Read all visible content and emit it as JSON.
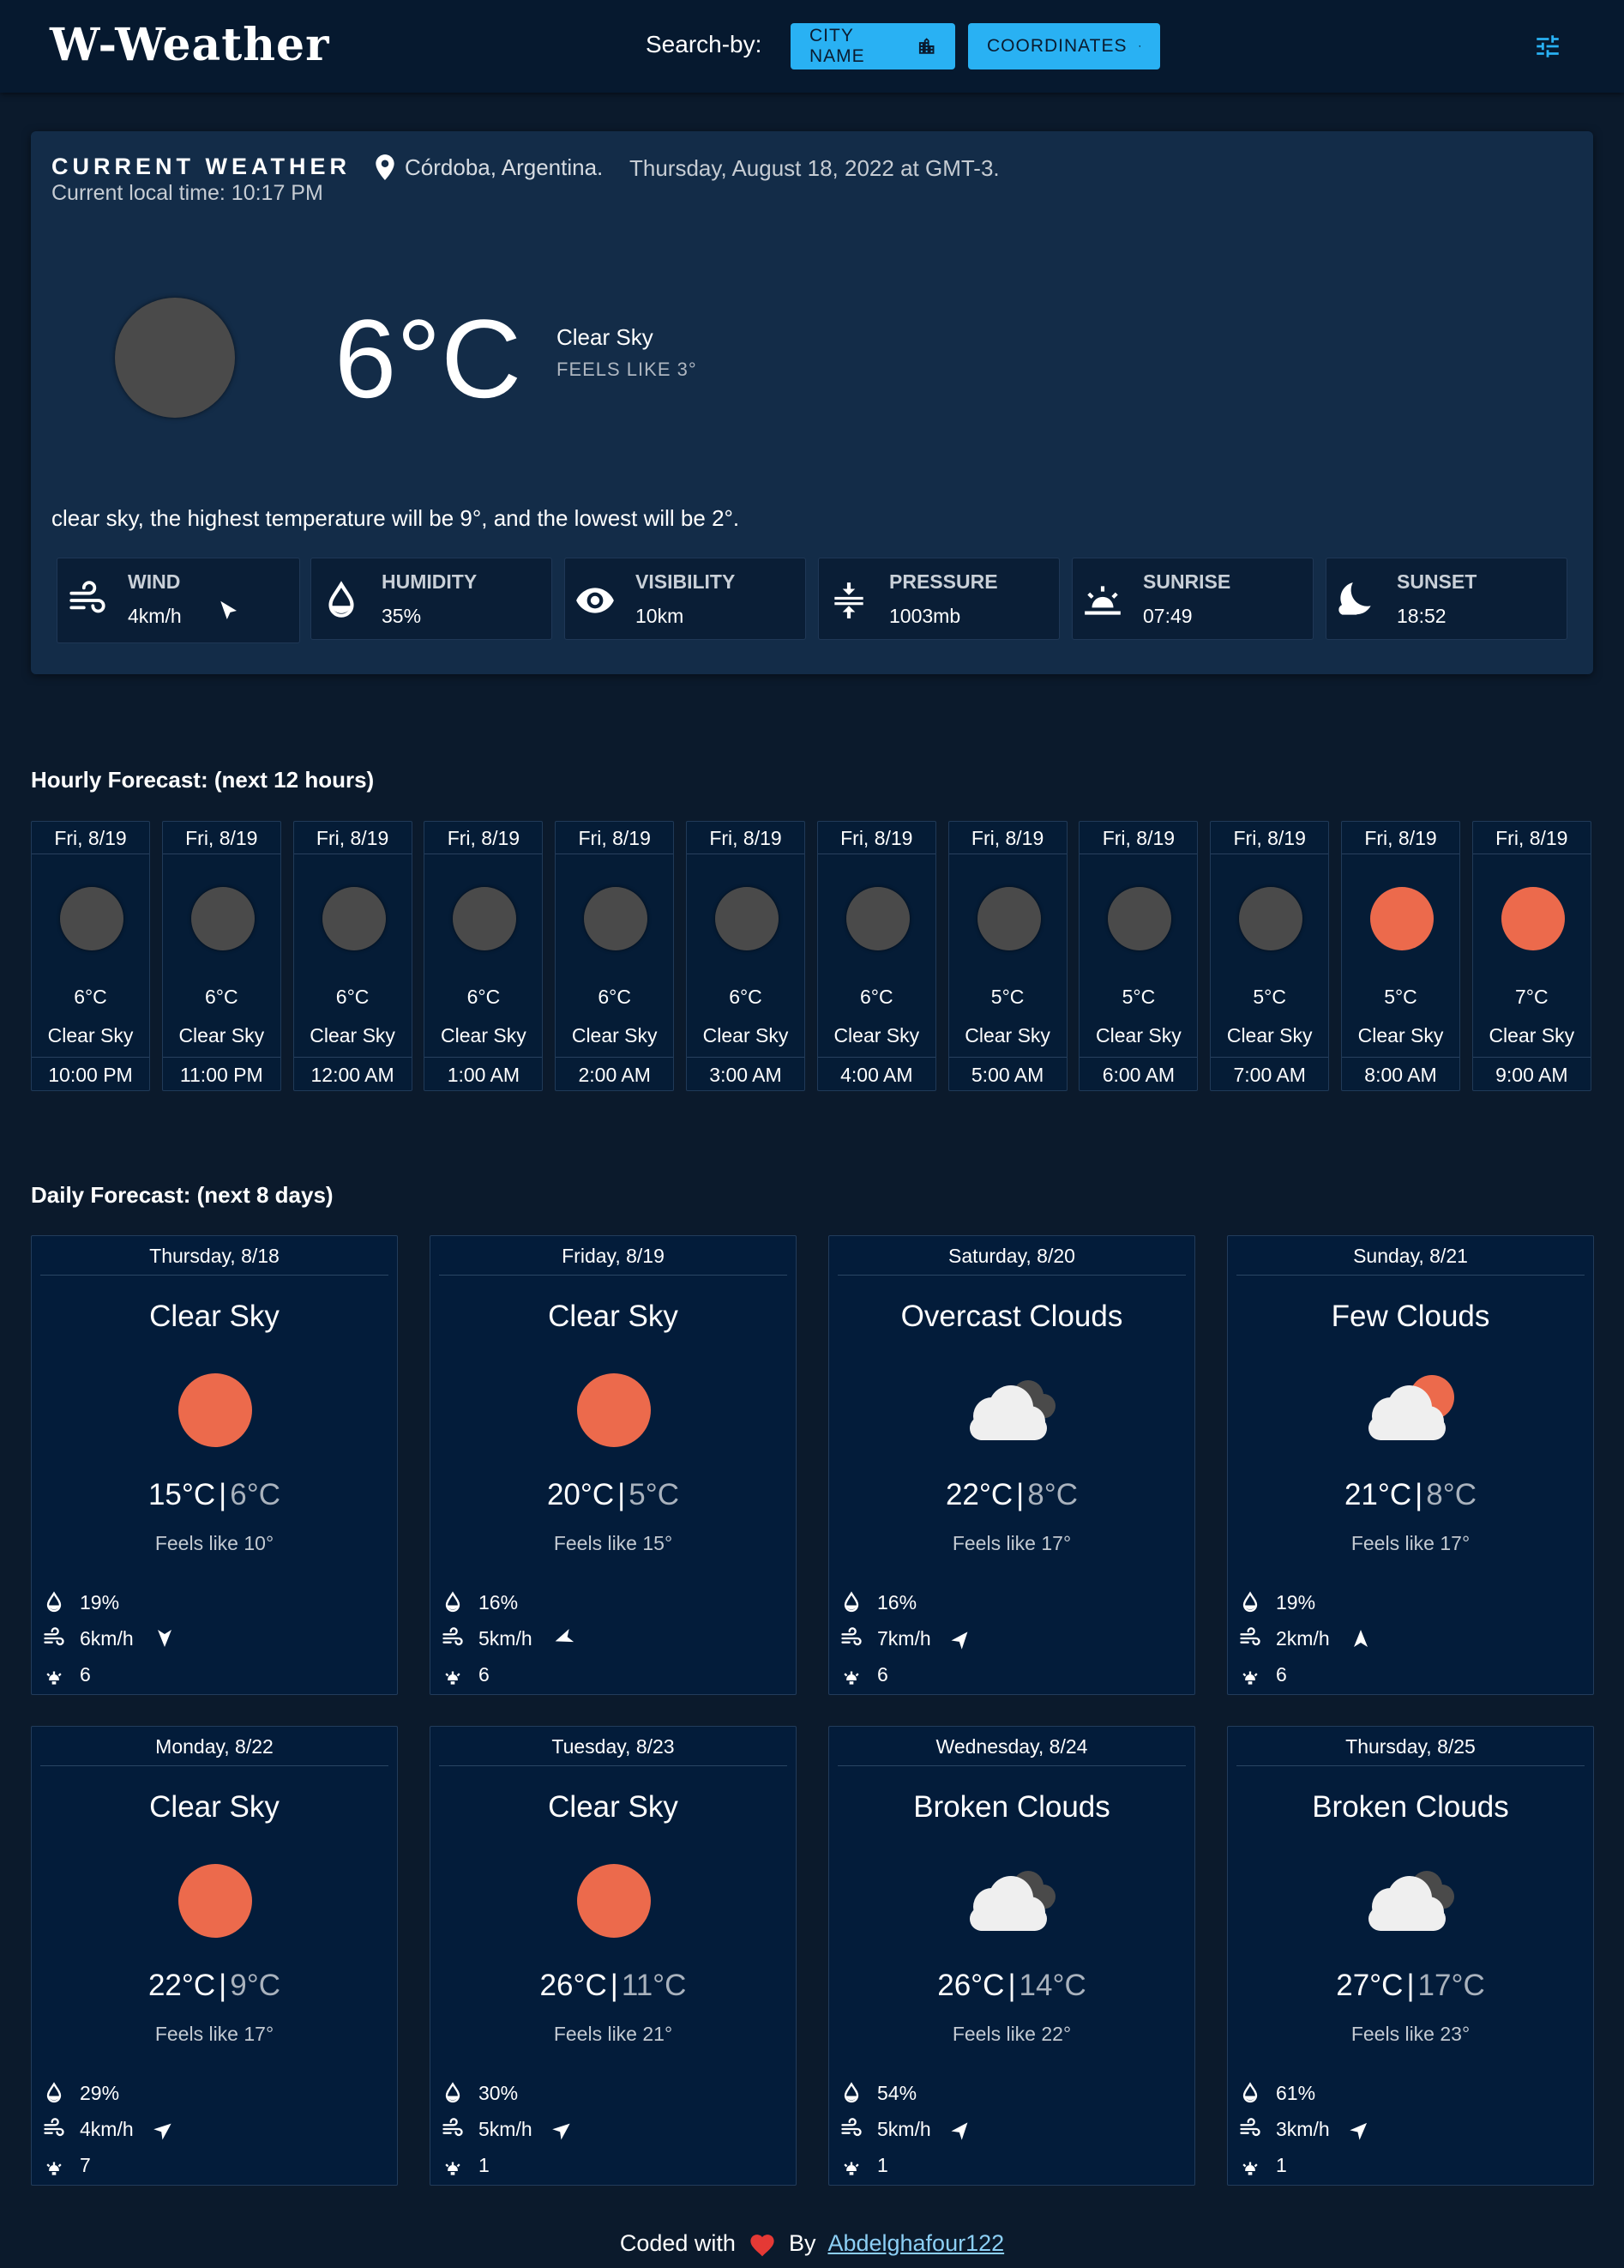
{
  "header": {
    "logo": "W-Weather",
    "search_label": "Search-by:",
    "city_button": "CITY NAME",
    "coords_button": "COORDINATES"
  },
  "current": {
    "title": "CURRENT WEATHER",
    "local_time": "Current local time: 10:17 PM",
    "location": "Córdoba, Argentina.",
    "date": "Thursday, August 18, 2022 at GMT-3.",
    "temperature": "6°C",
    "description": "Clear Sky",
    "feels_like": "FEELS LIKE 3°",
    "summary": "clear sky, the highest temperature will be 9°, and the lowest will be 2°.",
    "stats": [
      {
        "label": "WIND",
        "value": "4km/h",
        "icon": "wind-icon"
      },
      {
        "label": "HUMIDITY",
        "value": "35%",
        "icon": "humidity-icon"
      },
      {
        "label": "VISIBILITY",
        "value": "10km",
        "icon": "eye-icon"
      },
      {
        "label": "PRESSURE",
        "value": "1003mb",
        "icon": "pressure-icon"
      },
      {
        "label": "SUNRISE",
        "value": "07:49",
        "icon": "sunrise-icon"
      },
      {
        "label": "SUNSET",
        "value": "18:52",
        "icon": "moon-icon"
      }
    ]
  },
  "hourly": {
    "title": "Hourly Forecast: (next 12 hours)",
    "items": [
      {
        "day": "Fri, 8/19",
        "temp": "6°C",
        "desc": "Clear Sky",
        "time": "10:00 PM",
        "icon": "moon"
      },
      {
        "day": "Fri, 8/19",
        "temp": "6°C",
        "desc": "Clear Sky",
        "time": "11:00 PM",
        "icon": "moon"
      },
      {
        "day": "Fri, 8/19",
        "temp": "6°C",
        "desc": "Clear Sky",
        "time": "12:00 AM",
        "icon": "moon"
      },
      {
        "day": "Fri, 8/19",
        "temp": "6°C",
        "desc": "Clear Sky",
        "time": "1:00 AM",
        "icon": "moon"
      },
      {
        "day": "Fri, 8/19",
        "temp": "6°C",
        "desc": "Clear Sky",
        "time": "2:00 AM",
        "icon": "moon"
      },
      {
        "day": "Fri, 8/19",
        "temp": "6°C",
        "desc": "Clear Sky",
        "time": "3:00 AM",
        "icon": "moon"
      },
      {
        "day": "Fri, 8/19",
        "temp": "6°C",
        "desc": "Clear Sky",
        "time": "4:00 AM",
        "icon": "moon"
      },
      {
        "day": "Fri, 8/19",
        "temp": "5°C",
        "desc": "Clear Sky",
        "time": "5:00 AM",
        "icon": "moon"
      },
      {
        "day": "Fri, 8/19",
        "temp": "5°C",
        "desc": "Clear Sky",
        "time": "6:00 AM",
        "icon": "moon"
      },
      {
        "day": "Fri, 8/19",
        "temp": "5°C",
        "desc": "Clear Sky",
        "time": "7:00 AM",
        "icon": "moon"
      },
      {
        "day": "Fri, 8/19",
        "temp": "5°C",
        "desc": "Clear Sky",
        "time": "8:00 AM",
        "icon": "sun"
      },
      {
        "day": "Fri, 8/19",
        "temp": "7°C",
        "desc": "Clear Sky",
        "time": "9:00 AM",
        "icon": "sun"
      }
    ]
  },
  "daily": {
    "title": "Daily Forecast: (next 8 days)",
    "items": [
      {
        "day": "Thursday, 8/18",
        "desc": "Clear Sky",
        "icon": "sun",
        "high": "15°C",
        "low": "6°C",
        "feels": "Feels like 10°",
        "humidity": "19%",
        "wind": "6km/h",
        "uv": "6"
      },
      {
        "day": "Friday, 8/19",
        "desc": "Clear Sky",
        "icon": "sun",
        "high": "20°C",
        "low": "5°C",
        "feels": "Feels like 15°",
        "humidity": "16%",
        "wind": "5km/h",
        "uv": "6"
      },
      {
        "day": "Saturday, 8/20",
        "desc": "Overcast Clouds",
        "icon": "clouds",
        "high": "22°C",
        "low": "8°C",
        "feels": "Feels like 17°",
        "humidity": "16%",
        "wind": "7km/h",
        "uv": "6"
      },
      {
        "day": "Sunday, 8/21",
        "desc": "Few Clouds",
        "icon": "few-clouds",
        "high": "21°C",
        "low": "8°C",
        "feels": "Feels like 17°",
        "humidity": "19%",
        "wind": "2km/h",
        "uv": "6"
      },
      {
        "day": "Monday, 8/22",
        "desc": "Clear Sky",
        "icon": "sun",
        "high": "22°C",
        "low": "9°C",
        "feels": "Feels like 17°",
        "humidity": "29%",
        "wind": "4km/h",
        "uv": "7"
      },
      {
        "day": "Tuesday, 8/23",
        "desc": "Clear Sky",
        "icon": "sun",
        "high": "26°C",
        "low": "11°C",
        "feels": "Feels like 21°",
        "humidity": "30%",
        "wind": "5km/h",
        "uv": "1"
      },
      {
        "day": "Wednesday, 8/24",
        "desc": "Broken Clouds",
        "icon": "clouds",
        "high": "26°C",
        "low": "14°C",
        "feels": "Feels like 22°",
        "humidity": "54%",
        "wind": "5km/h",
        "uv": "1"
      },
      {
        "day": "Thursday, 8/25",
        "desc": "Broken Clouds",
        "icon": "clouds",
        "high": "27°C",
        "low": "17°C",
        "feels": "Feels like 23°",
        "humidity": "61%",
        "wind": "3km/h",
        "uv": "1"
      }
    ]
  },
  "footer": {
    "coded_with": "Coded with",
    "by": "By",
    "author": "Abdelghafour122"
  },
  "colors": {
    "background": "#0b1a2c",
    "header": "#06192f",
    "panel": "#132c48",
    "card": "#031c3a",
    "accent": "#29b1f3",
    "sun": "#ec6a4c",
    "moon": "#4a4a4a",
    "heart": "#e53935"
  }
}
